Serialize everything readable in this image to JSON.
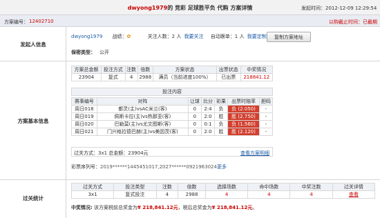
{
  "header": {
    "title_user": "dwyong1979",
    "title_rest": "的 竞彩 足球胜平负 代购 方案详情",
    "time_label": "发起时间：",
    "time_value": "2012-12-09 12:29:54"
  },
  "plan_bar": {
    "label": "方案编号：",
    "value": "12402710",
    "status": "以购截止时间：已截期"
  },
  "initiator": {
    "section_label": "发起人信息",
    "username": "dwyong1979",
    "record_label": "战绩：",
    "follow_label": "关注人数：",
    "follow_value": "2 人",
    "follow_link": "我要关注",
    "auto_label": "自动跟单：",
    "auto_value": "1 人",
    "auto_link": "我要定制",
    "copy_button": "复制方案地址",
    "secret_label": "保密类型：",
    "secret_value": "公开"
  },
  "basic": {
    "section_label": "方案基本信息",
    "summary_headers": [
      "方案总金额",
      "投注方式",
      "注数",
      "倍数",
      "方案状态",
      "出票状态",
      "中奖情况"
    ],
    "summary_row": [
      "23904",
      "复式",
      "4",
      "2988",
      "满员（当前进度100%）",
      "已出票",
      "218841.12"
    ],
    "bet_content_title": "投注内容",
    "match_headers": [
      "赛事编号",
      "对阵",
      "让球",
      "比分",
      "彩果",
      "出票时赔率",
      "胆码"
    ],
    "matches": [
      {
        "id": "周日018",
        "teams": "都灵(主)vsAC米兰(客)",
        "handicap": "0",
        "score": "2:4",
        "result": "负",
        "odds": "负 (2.050)",
        "banker": "-"
      },
      {
        "id": "周日019",
        "teams": "佩斯卡拉(主)vs热那亚(客)",
        "handicap": "0",
        "score": "2:0",
        "result": "胜",
        "odds": "胜 (2.750)",
        "banker": "-"
      },
      {
        "id": "周日020",
        "teams": "巴勒莫(主)vs尤文图斯(客)",
        "handicap": "0",
        "score": "0:1",
        "result": "负",
        "odds": "负 (1.560)",
        "banker": "-"
      },
      {
        "id": "周日021",
        "teams": "门兴格拉德巴赫(主)vs美因茨(客)",
        "handicap": "0",
        "score": "2:0",
        "result": "胜",
        "odds": "胜 (2.120)",
        "banker": "-"
      }
    ],
    "pass_text": "过关方式：3x1   总金额：23904元",
    "detail_link": "查看方案明细",
    "ticket_label": "彩票序列号：",
    "ticket_value": "2019******1445451017,2027******0921963024",
    "ticket_more": "更多"
  },
  "stats": {
    "section_label": "过关统计",
    "headers": [
      "过关方式",
      "投注类型",
      "注数",
      "倍数",
      "选择场数",
      "命中场数",
      "中奖注数",
      "过关详情"
    ],
    "row": [
      "3x1",
      "复式投注",
      "4",
      "2988",
      "4",
      "4",
      "4",
      "查看"
    ],
    "prize_label": "中奖情况:",
    "prize_text_1": "该方案税前总奖金为",
    "prize_pre": "¥ 218,841.12元",
    "prize_text_2": "，税后总奖金为",
    "prize_post": "¥ 218,841.12元",
    "prize_end": "。"
  },
  "colors": {
    "accent_red": "#c00",
    "odds_red": "#d2402f",
    "link_blue": "#1a5aa6"
  }
}
